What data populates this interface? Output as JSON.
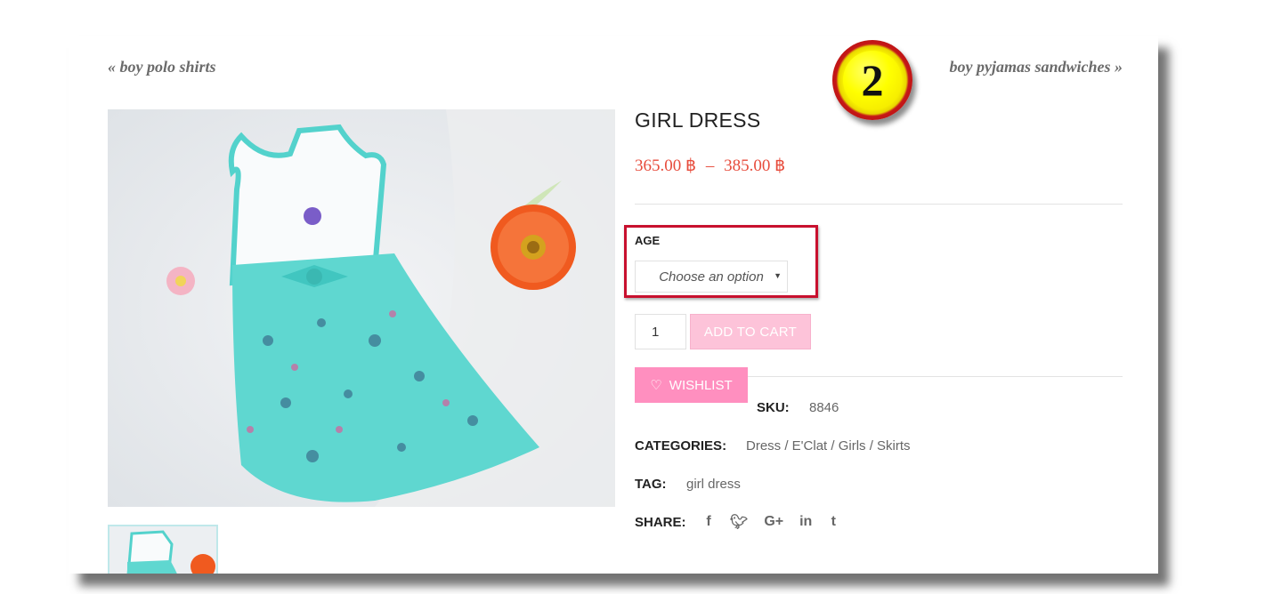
{
  "navigation": {
    "prev_label": "« boy polo shirts",
    "next_label": "boy pyjamas sandwiches »"
  },
  "annotation_badge": {
    "number": "2"
  },
  "product": {
    "title": "GIRL DRESS",
    "price_min": "365.00 ฿",
    "price_separator": "–",
    "price_max": "385.00 ฿"
  },
  "variation": {
    "label": "AGE",
    "placeholder": "Choose an option"
  },
  "cart": {
    "quantity": "1",
    "add_to_cart_label": "ADD TO CART",
    "wishlist_label": "WISHLIST"
  },
  "meta": {
    "sku_label": "SKU:",
    "sku_value": "8846",
    "categories_label": "CATEGORIES:",
    "categories_value": "Dress / E'Clat / Girls / Skirts",
    "tag_label": "TAG:",
    "tag_value": "girl dress",
    "share_label": "SHARE:",
    "share_icons": [
      {
        "name": "facebook-icon",
        "glyph": "f"
      },
      {
        "name": "twitter-icon",
        "glyph": "🐦︎"
      },
      {
        "name": "google-plus-icon",
        "glyph": "G+"
      },
      {
        "name": "linkedin-icon",
        "glyph": "in"
      },
      {
        "name": "tumblr-icon",
        "glyph": "t"
      }
    ]
  },
  "colors": {
    "price": "#e74c3c",
    "add_to_cart_bg": "#fdc3d9",
    "wishlist_bg": "#ff8fbf",
    "highlight_border": "#c8102e",
    "badge_fill": "#ffff00"
  }
}
